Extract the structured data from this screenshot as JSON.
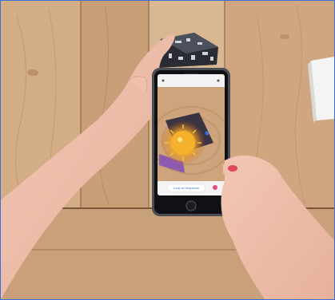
{
  "scene": {
    "subject": "Hands holding smartphone scanning AR cube on wooden table",
    "phone_ui": {
      "bottom_button_label": "Look at Sequence",
      "status_dot_color": "#3d6fd6",
      "pink_indicator_color": "#e64a7a"
    },
    "colors": {
      "wood_light": "#d5b08a",
      "wood_dark": "#b28561",
      "phone_body": "#4a4d53",
      "sun_glow": "#f3b73a"
    }
  }
}
